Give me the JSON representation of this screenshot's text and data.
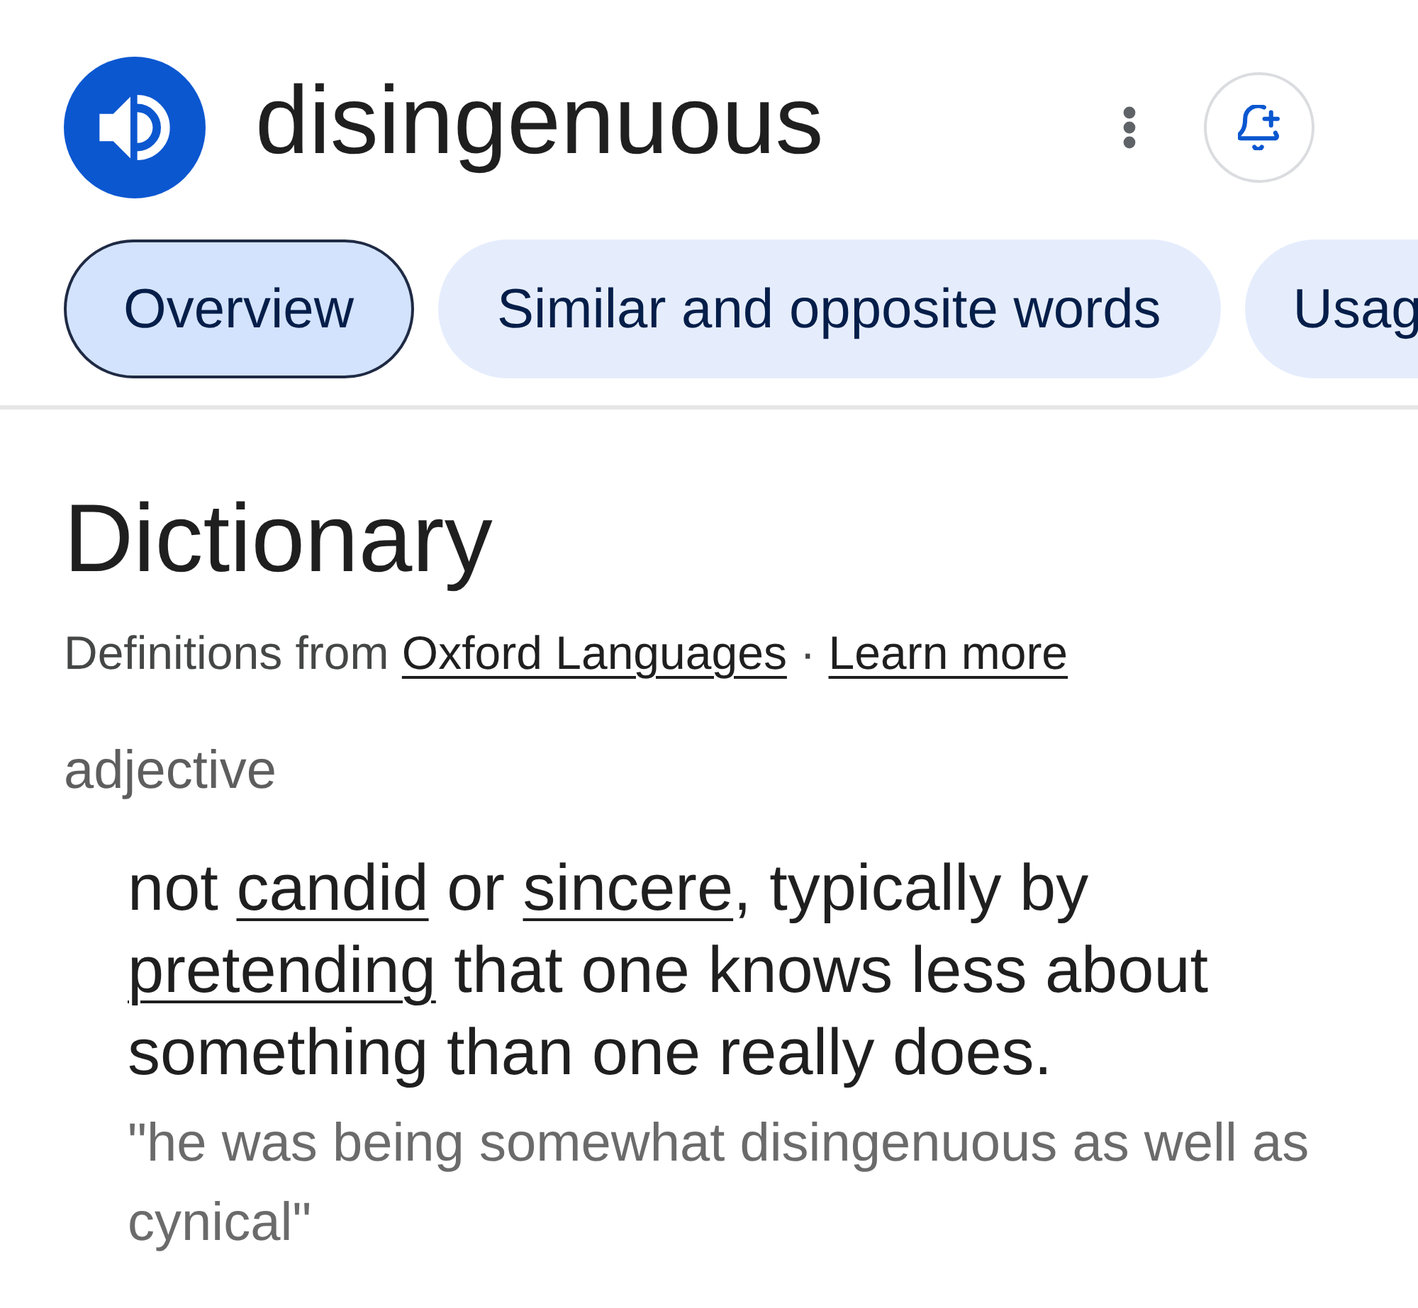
{
  "header": {
    "word": "disingenuous"
  },
  "tabs": [
    {
      "label": "Overview",
      "selected": true
    },
    {
      "label": "Similar and opposite words",
      "selected": false
    },
    {
      "label": "Usag",
      "selected": false
    }
  ],
  "dictionary": {
    "title": "Dictionary",
    "source": [
      {
        "kind": "text",
        "text": "Definitions from "
      },
      {
        "kind": "link",
        "text": "Oxford Languages"
      },
      {
        "kind": "text",
        "text": " · "
      },
      {
        "kind": "link",
        "text": "Learn more"
      }
    ],
    "part_of_speech": "adjective",
    "definition": [
      {
        "kind": "text",
        "text": "not "
      },
      {
        "kind": "link",
        "text": "candid"
      },
      {
        "kind": "text",
        "text": " or "
      },
      {
        "kind": "link",
        "text": "sincere"
      },
      {
        "kind": "text",
        "text": ", typically by "
      },
      {
        "kind": "link",
        "text": "pretending"
      },
      {
        "kind": "text",
        "text": " that one knows less about something than one really does."
      }
    ],
    "example": "\"he was being somewhat disingenuous as well as cynical\""
  }
}
